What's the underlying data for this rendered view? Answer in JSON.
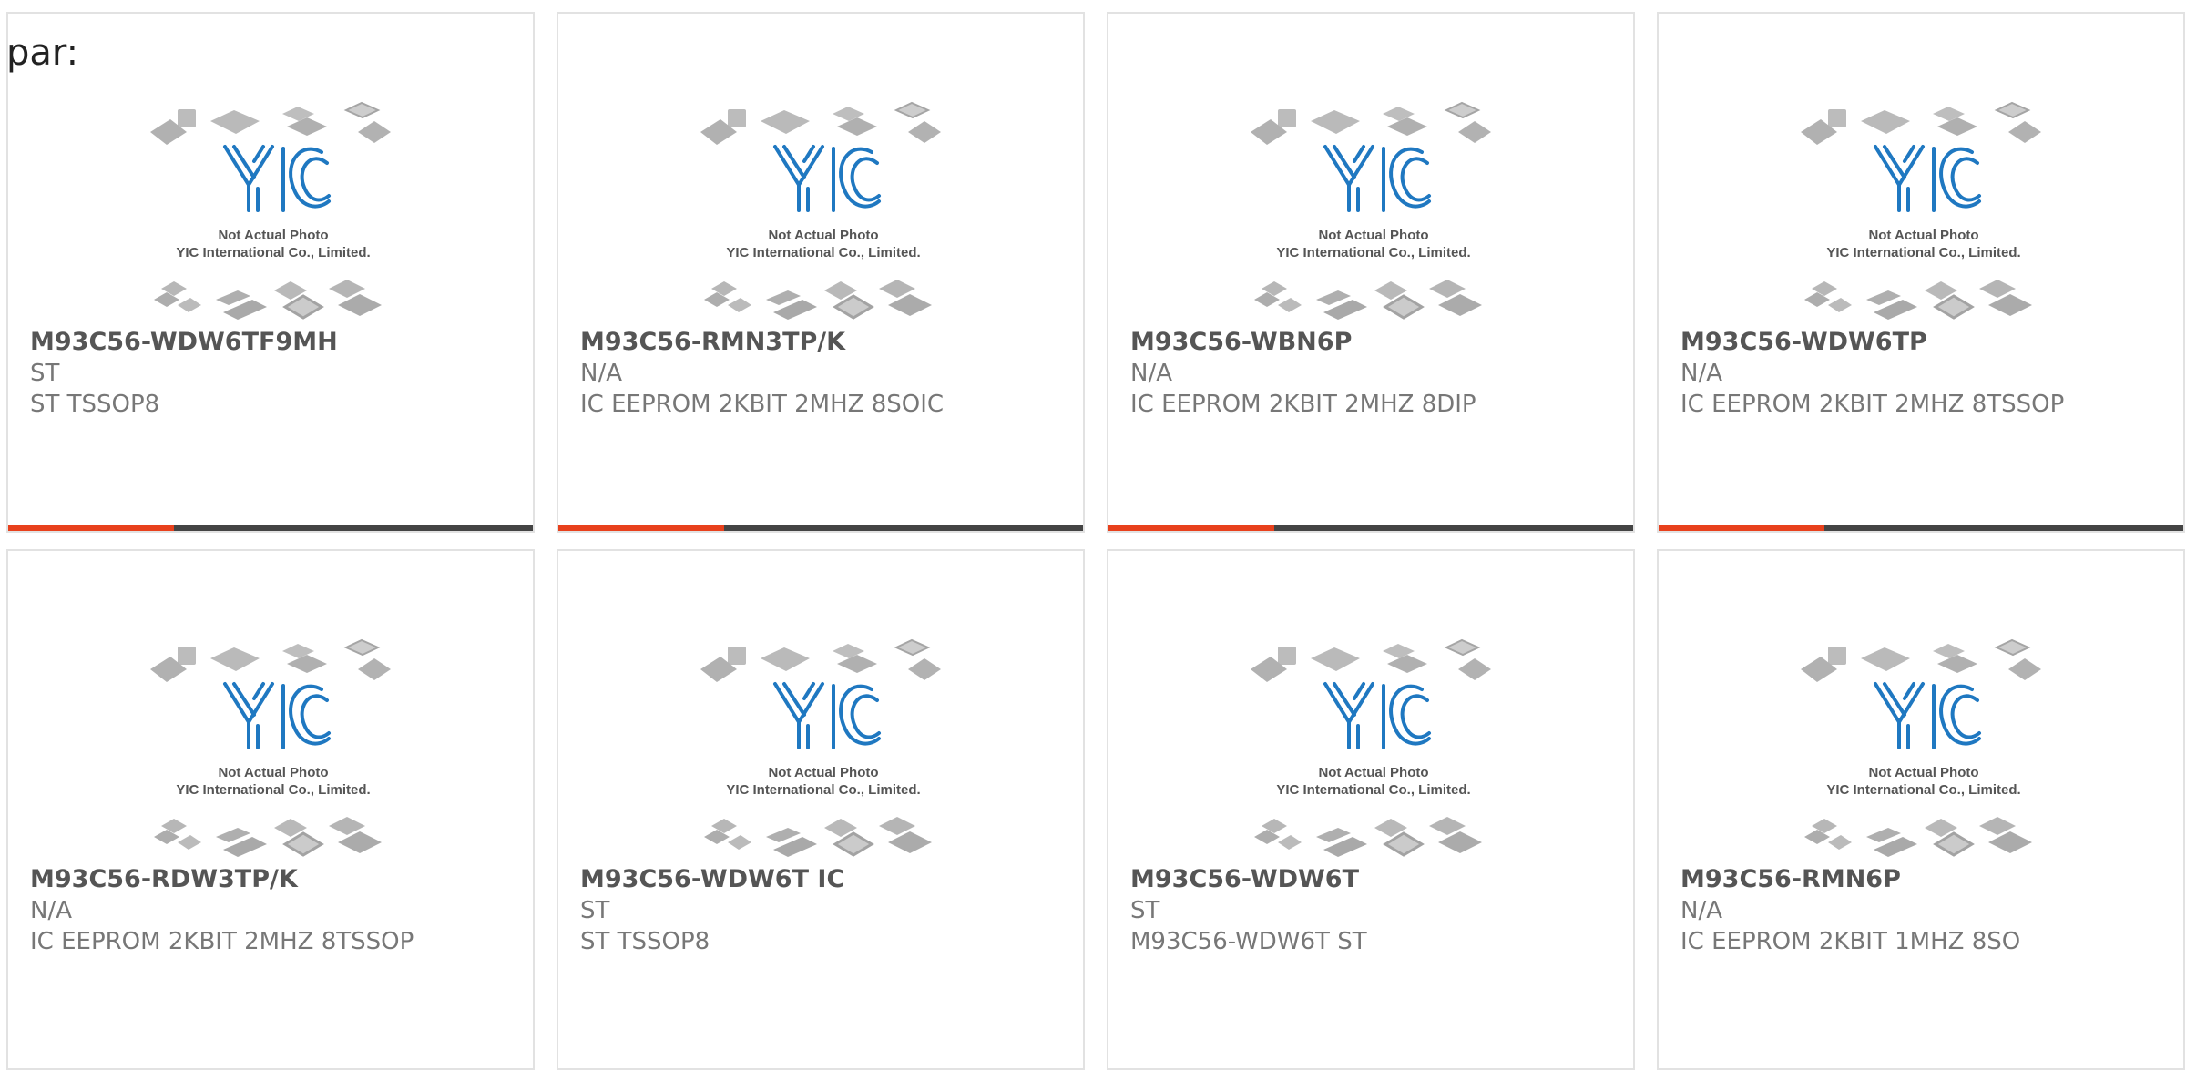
{
  "page": {
    "heading": "par:"
  },
  "colors": {
    "accent": "#e8401c",
    "bar": "#444444",
    "logo_blue": "#1f78c1"
  },
  "placeholder": {
    "logo_text": "YIC",
    "line1": "Not Actual Photo",
    "line2": "YIC International Co., Limited."
  },
  "products": [
    {
      "part": "M93C56-WDW6TF9MH",
      "maker": "ST",
      "desc": "ST TSSOP8"
    },
    {
      "part": "M93C56-RMN3TP/K",
      "maker": "N/A",
      "desc": "IC EEPROM 2KBIT 2MHZ 8SOIC"
    },
    {
      "part": "M93C56-WBN6P",
      "maker": "N/A",
      "desc": "IC EEPROM 2KBIT 2MHZ 8DIP"
    },
    {
      "part": "M93C56-WDW6TP",
      "maker": "N/A",
      "desc": "IC EEPROM 2KBIT 2MHZ 8TSSOP"
    },
    {
      "part": "M93C56-RDW3TP/K",
      "maker": "N/A",
      "desc": "IC EEPROM 2KBIT 2MHZ 8TSSOP"
    },
    {
      "part": "M93C56-WDW6T IC",
      "maker": "ST",
      "desc": "ST TSSOP8"
    },
    {
      "part": "M93C56-WDW6T",
      "maker": "ST",
      "desc": "M93C56-WDW6T ST"
    },
    {
      "part": "M93C56-RMN6P",
      "maker": "N/A",
      "desc": "IC EEPROM 2KBIT 1MHZ 8SO"
    }
  ]
}
